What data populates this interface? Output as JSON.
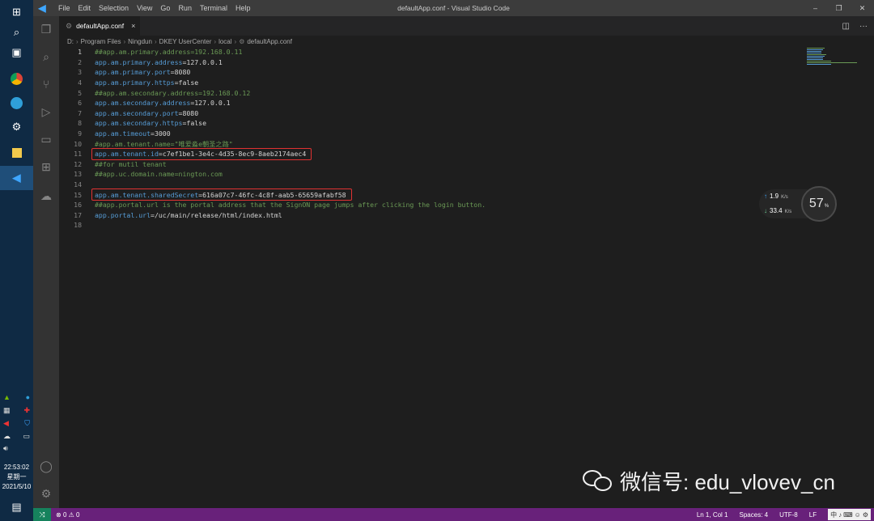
{
  "window": {
    "title": "defaultApp.conf - Visual Studio Code",
    "controls": [
      "–",
      "❐",
      "✕"
    ]
  },
  "menu": [
    "File",
    "Edit",
    "Selection",
    "View",
    "Go",
    "Run",
    "Terminal",
    "Help"
  ],
  "tab": {
    "label": "defaultApp.conf",
    "close": "×"
  },
  "breadcrumb": [
    "D:",
    "Program Files",
    "Ningdun",
    "DKEY UserCenter",
    "local",
    "defaultApp.conf"
  ],
  "code": [
    {
      "n": "1",
      "key": "##app.am.primary.address",
      "val": "192.168.0.11",
      "comment": true
    },
    {
      "n": "2",
      "key": "app.am.primary.address",
      "val": "127.0.0.1"
    },
    {
      "n": "3",
      "key": "app.am.primary.port",
      "val": "8080"
    },
    {
      "n": "4",
      "key": "app.am.primary.https",
      "val": "false"
    },
    {
      "n": "5",
      "key": "##app.am.secondary.address",
      "val": "192.168.0.12",
      "comment": true
    },
    {
      "n": "6",
      "key": "app.am.secondary.address",
      "val": "127.0.0.1"
    },
    {
      "n": "7",
      "key": "app.am.secondary.port",
      "val": "8080"
    },
    {
      "n": "8",
      "key": "app.am.secondary.https",
      "val": "false"
    },
    {
      "n": "9",
      "key": "app.am.timeout",
      "val": "3000"
    },
    {
      "n": "10",
      "key": "#app.am.tenant.name",
      "val": "\"唯爱淼e朝圣之路\"",
      "comment": true
    },
    {
      "n": "11",
      "key": "app.am.tenant.id",
      "val": "c7ef1be1-3e4c-4d35-8ec9-8aeb2174aec4",
      "highlight": true
    },
    {
      "n": "12",
      "key": "##for mutil tenant",
      "val": "",
      "comment": true
    },
    {
      "n": "13",
      "key": "##app.uc.domain.name",
      "val": "nington.com",
      "comment": true
    },
    {
      "n": "14",
      "key": "",
      "val": ""
    },
    {
      "n": "15",
      "key": "app.am.tenant.sharedSecret",
      "val": "616a07c7-46fc-4c8f-aab5-65659afabf58",
      "highlight": true
    },
    {
      "n": "16",
      "key": "##app.portal.url is the portal address that the SignON page jumps after clicking the login button.",
      "val": "",
      "comment": true
    },
    {
      "n": "17",
      "key": "app.portal.url",
      "val": "/uc/main/release/html/index.html"
    },
    {
      "n": "18",
      "key": "",
      "val": ""
    }
  ],
  "network": {
    "up": "1.9",
    "up_unit": "K/s",
    "down": "33.4",
    "down_unit": "K/s",
    "percent": "57",
    "percent_unit": "%"
  },
  "watermark": "微信号: edu_vlovev_cn",
  "status": {
    "errors": "0",
    "warnings": "0",
    "position": "Ln 1, Col 1",
    "spaces": "Spaces: 4",
    "encoding": "UTF-8",
    "eol": "LF",
    "ime": [
      "中",
      "♪",
      "⌨",
      "☺",
      "⚙"
    ]
  },
  "taskbar": {
    "time": "22:53:02",
    "weekday": "星期一",
    "date": "2021/5/10"
  },
  "colors": {
    "statusbar": "#68217a",
    "highlight_box": "#e03232",
    "key": "#569cd6",
    "comment": "#6a9955"
  }
}
